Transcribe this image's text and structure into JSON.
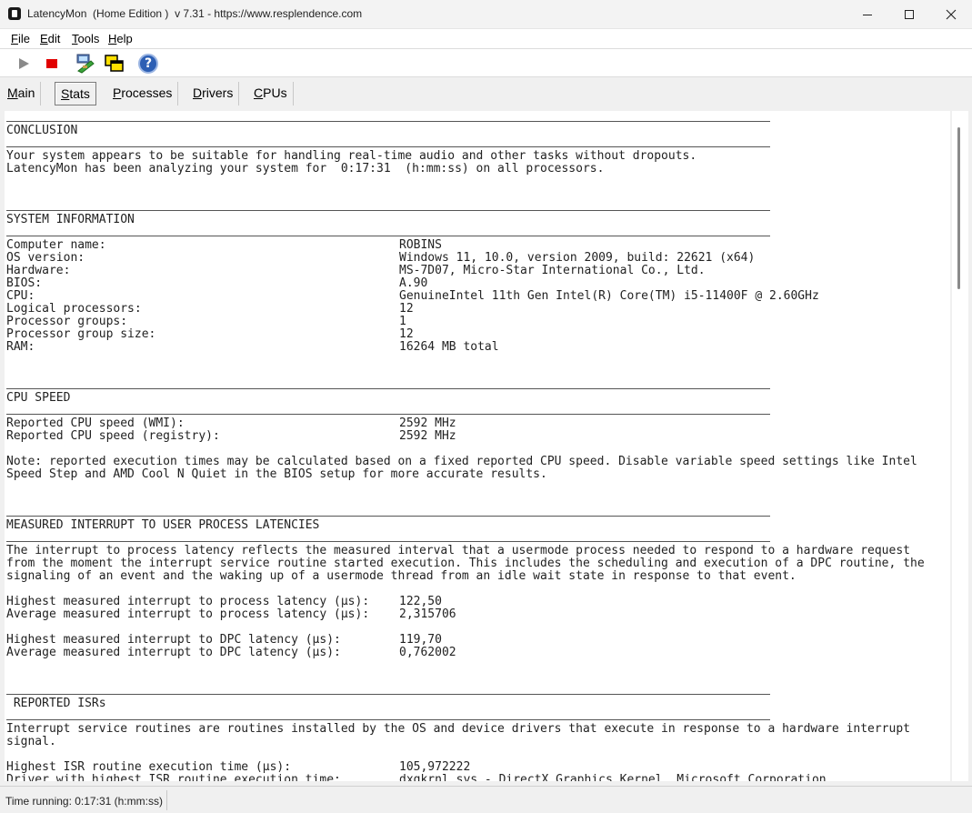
{
  "window": {
    "title": "LatencyMon  (Home Edition )  v 7.31 - https://www.resplendence.com",
    "icon": "latencymon-app-icon"
  },
  "menu": [
    "File",
    "Edit",
    "Tools",
    "Help"
  ],
  "toolbar": {
    "buttons": [
      {
        "name": "play-icon",
        "color": "#8a8a8a"
      },
      {
        "name": "stop-icon",
        "color": "#e10000"
      },
      {
        "name": "network-adapter-icon"
      },
      {
        "name": "windows-icon"
      },
      {
        "name": "help-icon",
        "label": "?",
        "color": "#2d5fb4"
      }
    ]
  },
  "tabs": [
    {
      "label": "Main",
      "active": false
    },
    {
      "label": "Stats",
      "active": true
    },
    {
      "label": "Processes",
      "active": false
    },
    {
      "label": "Drivers",
      "active": false
    },
    {
      "label": "CPUs",
      "active": false
    }
  ],
  "report": {
    "conclusion": {
      "heading": "CONCLUSION",
      "lines": [
        "Your system appears to be suitable for handling real-time audio and other tasks without dropouts.",
        "LatencyMon has been analyzing your system for  0:17:31  (h:mm:ss) on all processors."
      ]
    },
    "system_information": {
      "heading": "SYSTEM INFORMATION",
      "rows": [
        {
          "label": "Computer name:",
          "value": "ROBINS"
        },
        {
          "label": "OS version:",
          "value": "Windows 11, 10.0, version 2009, build: 22621 (x64)"
        },
        {
          "label": "Hardware:",
          "value": "MS-7D07, Micro-Star International Co., Ltd."
        },
        {
          "label": "BIOS:",
          "value": "A.90"
        },
        {
          "label": "CPU:",
          "value": "GenuineIntel 11th Gen Intel(R) Core(TM) i5-11400F @ 2.60GHz"
        },
        {
          "label": "Logical processors:",
          "value": "12"
        },
        {
          "label": "Processor groups:",
          "value": "1"
        },
        {
          "label": "Processor group size:",
          "value": "12"
        },
        {
          "label": "RAM:",
          "value": "16264 MB total"
        }
      ]
    },
    "cpu_speed": {
      "heading": "CPU SPEED",
      "rows": [
        {
          "label": "Reported CPU speed (WMI):",
          "value": "2592 MHz"
        },
        {
          "label": "Reported CPU speed (registry):",
          "value": "2592 MHz"
        }
      ],
      "note": [
        "Note: reported execution times may be calculated based on a fixed reported CPU speed. Disable variable speed settings like Intel",
        "Speed Step and AMD Cool N Quiet in the BIOS setup for more accurate results."
      ]
    },
    "interrupt_latencies": {
      "heading": "MEASURED INTERRUPT TO USER PROCESS LATENCIES",
      "description": [
        "The interrupt to process latency reflects the measured interval that a usermode process needed to respond to a hardware request",
        "from the moment the interrupt service routine started execution. This includes the scheduling and execution of a DPC routine, the",
        "signaling of an event and the waking up of a usermode thread from an idle wait state in response to that event."
      ],
      "process_rows": [
        {
          "label": "Highest measured interrupt to process latency (µs):",
          "value": "122,50"
        },
        {
          "label": "Average measured interrupt to process latency (µs):",
          "value": "2,315706"
        }
      ],
      "dpc_rows": [
        {
          "label": "Highest measured interrupt to DPC latency (µs):",
          "value": "119,70"
        },
        {
          "label": "Average measured interrupt to DPC latency (µs):",
          "value": "0,762002"
        }
      ]
    },
    "reported_isrs": {
      "heading": " REPORTED ISRs",
      "description": [
        "Interrupt service routines are routines installed by the OS and device drivers that execute in response to a hardware interrupt",
        "signal."
      ],
      "rows": [
        {
          "label": "Highest ISR routine execution time (µs):",
          "value": "105,972222"
        },
        {
          "label": "Driver with highest ISR routine execution time:",
          "value": "dxgkrnl.sys - DirectX Graphics Kernel, Microsoft Corporation"
        }
      ]
    }
  },
  "status": {
    "text": "Time running: 0:17:31  (h:mm:ss)"
  }
}
